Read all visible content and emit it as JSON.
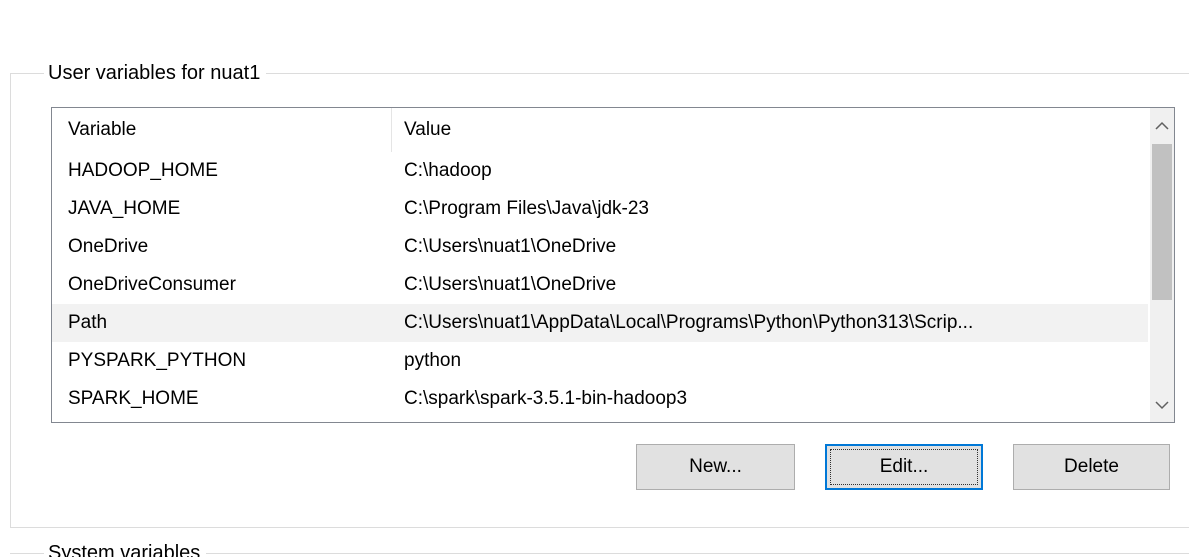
{
  "user_group": {
    "title": "User variables for nuat1"
  },
  "list": {
    "headers": {
      "variable": "Variable",
      "value": "Value"
    },
    "rows": [
      {
        "variable": "HADOOP_HOME",
        "value": "C:\\hadoop"
      },
      {
        "variable": "JAVA_HOME",
        "value": "C:\\Program Files\\Java\\jdk-23"
      },
      {
        "variable": "OneDrive",
        "value": "C:\\Users\\nuat1\\OneDrive"
      },
      {
        "variable": "OneDriveConsumer",
        "value": "C:\\Users\\nuat1\\OneDrive"
      },
      {
        "variable": "Path",
        "value": "C:\\Users\\nuat1\\AppData\\Local\\Programs\\Python\\Python313\\Scrip..."
      },
      {
        "variable": "PYSPARK_PYTHON",
        "value": "python"
      },
      {
        "variable": "SPARK_HOME",
        "value": "C:\\spark\\spark-3.5.1-bin-hadoop3"
      }
    ],
    "selected_row": "Path"
  },
  "buttons": {
    "new_label": "New...",
    "edit_label": "Edit...",
    "delete_label": "Delete"
  },
  "system_group": {
    "title": "System variables"
  },
  "colors": {
    "focus_border": "#0078d7",
    "button_face": "#e1e1e1",
    "selected_row": "#f2f2f2",
    "scroll_thumb": "#c1c1c1"
  },
  "icons": {
    "scroll_up": "chevron-up-icon",
    "scroll_down": "chevron-down-icon"
  }
}
